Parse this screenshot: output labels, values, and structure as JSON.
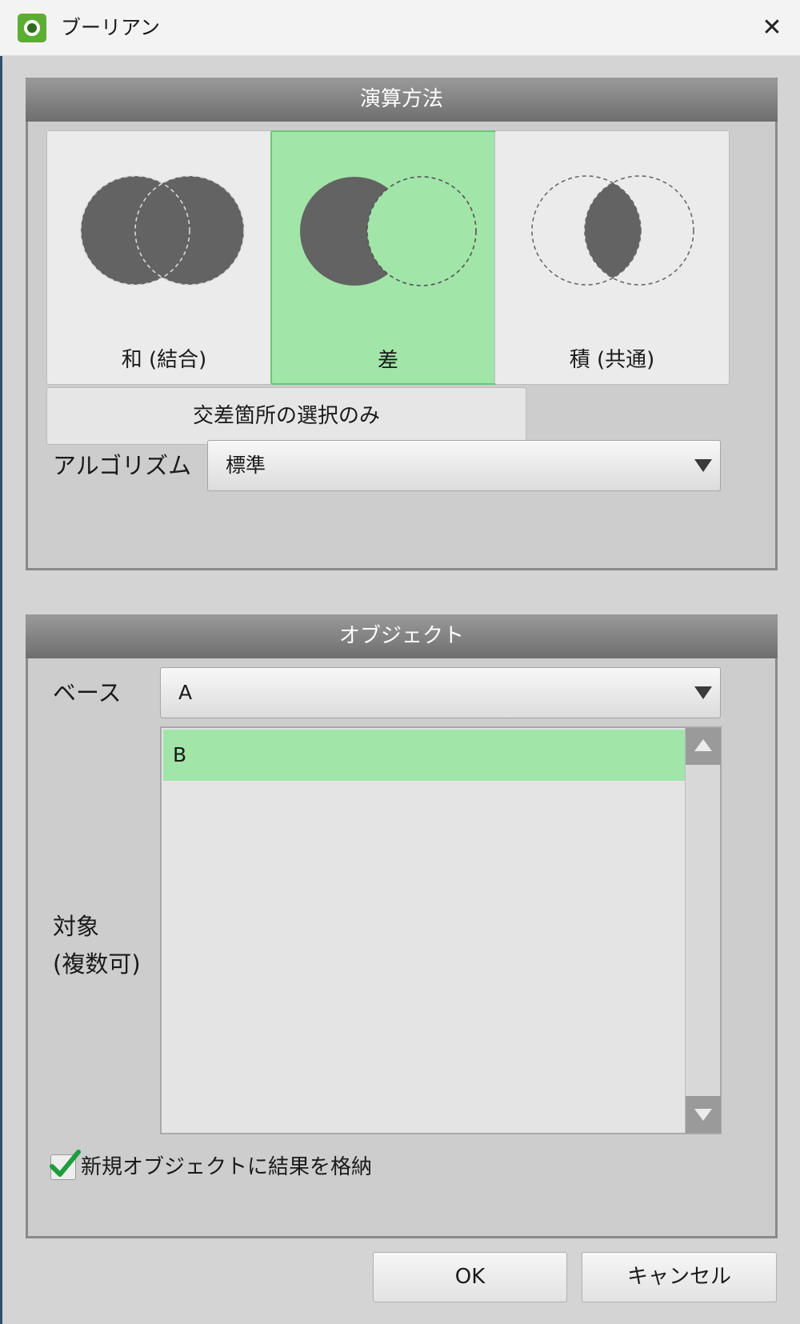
{
  "window": {
    "title": "ブーリアン",
    "close_glyph": "✕"
  },
  "operation": {
    "header": "演算方法",
    "options": [
      {
        "label": "和 (結合)",
        "selected": false
      },
      {
        "label": "差",
        "selected": true
      },
      {
        "label": "積 (共通)",
        "selected": false
      }
    ],
    "intersect_only_label": "交差箇所の選択のみ",
    "algorithm": {
      "label": "アルゴリズム",
      "value": "標準"
    }
  },
  "objects": {
    "header": "オブジェクト",
    "base": {
      "label": "ベース",
      "value": "A"
    },
    "target": {
      "label_line1": "対象",
      "label_line2": "(複数可)",
      "items": [
        {
          "label": "B",
          "selected": true
        }
      ]
    },
    "store_new": {
      "label": "新規オブジェクトに結果を格納",
      "checked": true
    }
  },
  "buttons": {
    "ok": "OK",
    "cancel": "キャンセル"
  },
  "colors": {
    "selection_green": "#a1e5a9",
    "shape_dark": "#636363",
    "check_green": "#1e9e3e",
    "header_gray": "#7e7e7e"
  },
  "icons": {
    "app": "app-logo-icon",
    "close": "close-icon",
    "dropdown": "triangle-down-icon",
    "checkmark": "checkmark-icon"
  }
}
